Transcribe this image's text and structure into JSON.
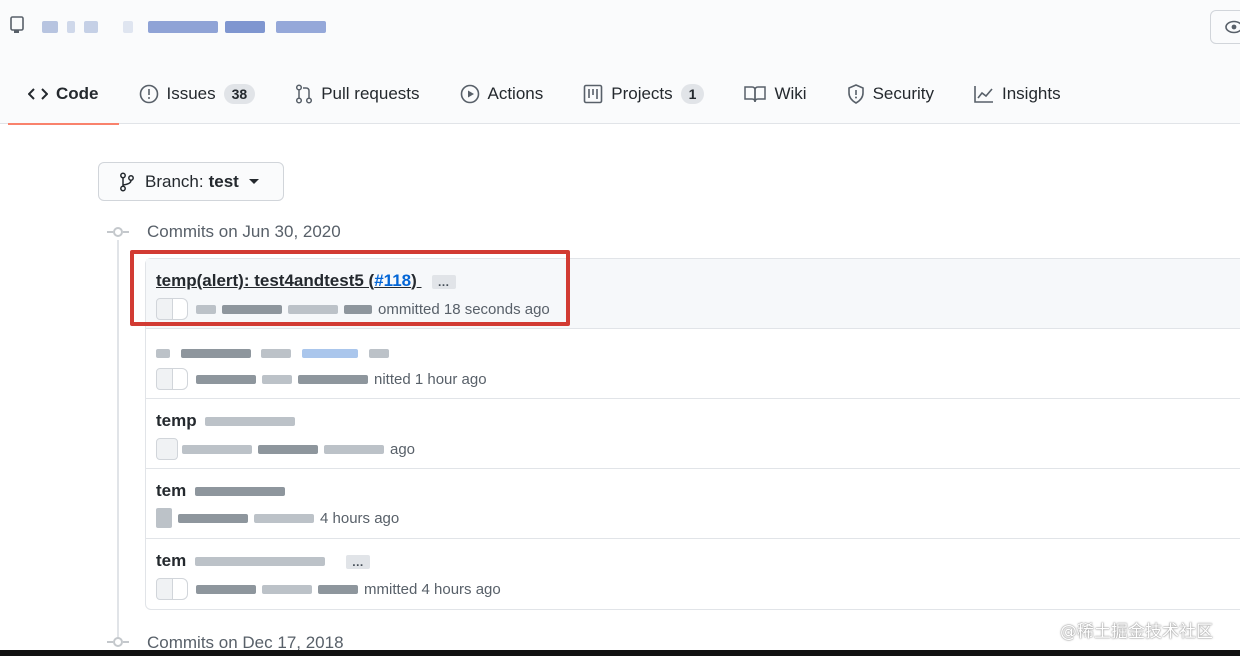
{
  "repo": {
    "title": "",
    "icon": "repo-icon"
  },
  "tabs": [
    {
      "label": "Code",
      "icon": "code-icon",
      "selected": true
    },
    {
      "label": "Issues",
      "icon": "issue-icon",
      "counter": "38"
    },
    {
      "label": "Pull requests",
      "icon": "pull-request-icon"
    },
    {
      "label": "Actions",
      "icon": "play-icon"
    },
    {
      "label": "Projects",
      "icon": "project-icon",
      "counter": "1"
    },
    {
      "label": "Wiki",
      "icon": "book-icon"
    },
    {
      "label": "Security",
      "icon": "shield-icon"
    },
    {
      "label": "Insights",
      "icon": "graph-icon"
    }
  ],
  "branch": {
    "label": "Branch:",
    "name": "test"
  },
  "groups": [
    {
      "header": "Commits on Jun 30, 2020"
    },
    {
      "header": "Commits on Dec 17, 2018"
    }
  ],
  "commits": [
    {
      "title": "temp(alert): test4andtest5 (",
      "pr": "#118",
      "title_end": ")",
      "meta": "ommitted 18 seconds ago",
      "highlighted": true
    },
    {
      "title": "",
      "meta": "nitted 1 hour ago"
    },
    {
      "title": "temp",
      "meta": "ago"
    },
    {
      "title": "tem",
      "meta": "4 hours ago"
    },
    {
      "title": "tem",
      "meta": "mmitted 4 hours ago"
    }
  ],
  "ellipsis": "…",
  "watermark": "@稀土掘金技术社区",
  "colors": {
    "accent_underline": "#f9826c",
    "link": "#0366d6",
    "highlight_box": "#d23b33"
  }
}
